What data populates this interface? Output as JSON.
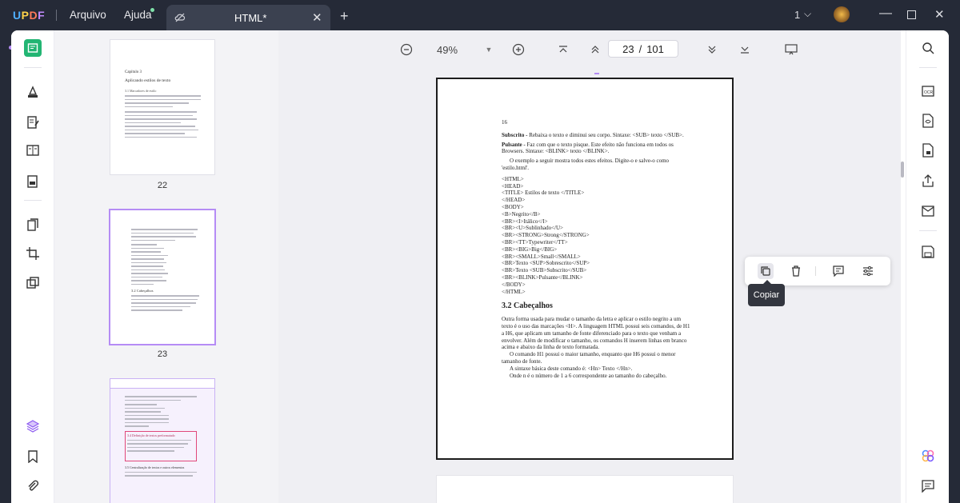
{
  "app": {
    "logo": "UPDF",
    "menu_file": "Arquivo",
    "menu_help": "Ajuda",
    "tab_title": "HTML*",
    "page_counter_label": "1"
  },
  "toolbar": {
    "zoom": "49%",
    "current_page": "23",
    "page_separator": "/",
    "total_pages": "101"
  },
  "thumbnails": [
    {
      "label": "22",
      "chapter": "Capítulo 3",
      "heading": "Aplicando estilos de texto",
      "section": "3.1 Marcadores de estilo"
    },
    {
      "label": "23",
      "section": "3.2 Cabeçalhos"
    },
    {
      "label": "",
      "section": "3.4 Definição de textos preformatado",
      "section2": "3.5 Centralização de textos e outros elementos"
    }
  ],
  "document": {
    "page_number": "16",
    "p1_term": "Subscrito -",
    "p1_text": "Rebaixa o texto e diminui seu corpo. Sintaxe: <SUB> texto </SUB>.",
    "p2_term": "Pulsante -",
    "p2_text": "Faz com que o texto pisque. Este efeito não funciona em todos os Browsers. Sintaxe: <BLINK> texto </BLINK>.",
    "p3": "O exemplo a seguir mostra todos estes efeitos. Digite-o e salve-o como 'estilo.html'.",
    "code": [
      "<HTML>",
      "<HEAD>",
      "<TITLE> Estilos de texto </TITLE>",
      "</HEAD>",
      "<BODY>",
      "<B>Negrito</B>",
      "<BR><I>Itálico</I>",
      "<BR><U>Sublinhado</U>",
      "<BR><STRONG>Strong</STRONG>",
      "<BR><TT>Typewriter</TT>",
      "<BR><BIG>Big</BIG>",
      "<BR><SMALL>Small</SMALL>",
      "<BR>Texto <SUP>Sobrescrito</SUP>",
      "<BR>Texto <SUB>Subscrito</SUB>",
      "<BR><BLINK>Pulsante</BLINK>",
      "</BODY>",
      "</HTML>"
    ],
    "section_title": "3.2 Cabeçalhos",
    "s1": "Outra forma usada para mudar o tamanho da letra e aplicar o estilo negrito a um texto é o uso das marcações <H>. A linguagem HTML possui seis comandos, de H1 a H6, que aplicam um tamanho de fonte diferenciado para o texto que venham a envolver. Além de modificar o tamanho, os comandos H inserem linhas em branco acima e abaixo da linha de texto formatada.",
    "s2": "O comando H1 possui o maior tamanho, enquanto que H6 possui o menor tamanho de fonte.",
    "s3": "A sintaxe básica deste comando é: <Hn> Texto </Hn>.",
    "s4": "Onde n é o número de 1 a 6 correspondente ao tamanho do cabeçalho."
  },
  "float_toolbar": {
    "tooltip": "Copiar"
  },
  "colors": {
    "accent": "#b58cf5",
    "titlebar": "#252a37",
    "brand_green": "#22b573"
  }
}
